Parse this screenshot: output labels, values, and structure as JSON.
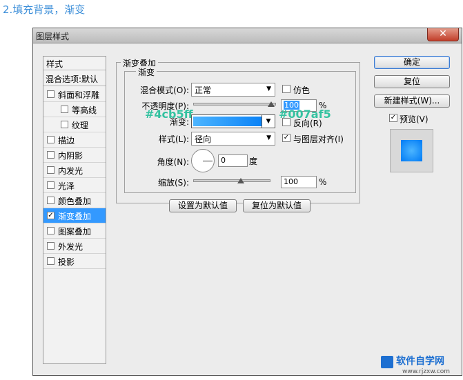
{
  "step_heading": "2.填充背景，渐变",
  "dialog": {
    "title": "图层样式",
    "close_glyph": "✕"
  },
  "styles_panel": {
    "header": "样式",
    "blend_options": "混合选项:默认",
    "items": [
      {
        "label": "斜面和浮雕",
        "checked": false
      },
      {
        "label": "等高线",
        "checked": false
      },
      {
        "label": "纹理",
        "checked": false
      },
      {
        "label": "描边",
        "checked": false
      },
      {
        "label": "内阴影",
        "checked": false
      },
      {
        "label": "内发光",
        "checked": false
      },
      {
        "label": "光泽",
        "checked": false
      },
      {
        "label": "颜色叠加",
        "checked": false
      },
      {
        "label": "渐变叠加",
        "checked": true
      },
      {
        "label": "图案叠加",
        "checked": false
      },
      {
        "label": "外发光",
        "checked": false
      },
      {
        "label": "投影",
        "checked": false
      }
    ],
    "check_glyph": "✓"
  },
  "gradient_overlay": {
    "group_title": "渐变叠加",
    "sub_title": "渐变",
    "blend_mode_label": "混合模式(O):",
    "blend_mode_value": "正常",
    "dither_label": "仿色",
    "opacity_label": "不透明度(P):",
    "opacity_value": "100",
    "opacity_unit": "%",
    "gradient_label": "渐变:",
    "reverse_label": "反向(R)",
    "style_label": "样式(L):",
    "style_value": "径向",
    "align_label": "与图层对齐(I)",
    "angle_label": "角度(N):",
    "angle_value": "0",
    "angle_unit": "度",
    "scale_label": "缩放(S):",
    "scale_value": "100",
    "scale_unit": "%",
    "make_default": "设置为默认值",
    "reset_default": "复位为默认值",
    "align_checked": true,
    "reverse_checked": false,
    "dither_checked": false,
    "opacity_level": 1.0,
    "scale_level": 0.5
  },
  "annotations": {
    "color_start": "#4cb5ff",
    "color_end": "#007af5"
  },
  "right_buttons": {
    "ok": "确定",
    "reset": "复位",
    "new_style": "新建样式(W)...",
    "preview_label": "预览(V)",
    "preview_checked": true
  },
  "watermark": {
    "text": "软件自学网",
    "url": "www.rjzxw.com"
  },
  "colors": {
    "accent": "#3399ff",
    "gradient_from": "#4cb5ff",
    "gradient_to": "#007af5",
    "annotation": "#33c2a0"
  }
}
